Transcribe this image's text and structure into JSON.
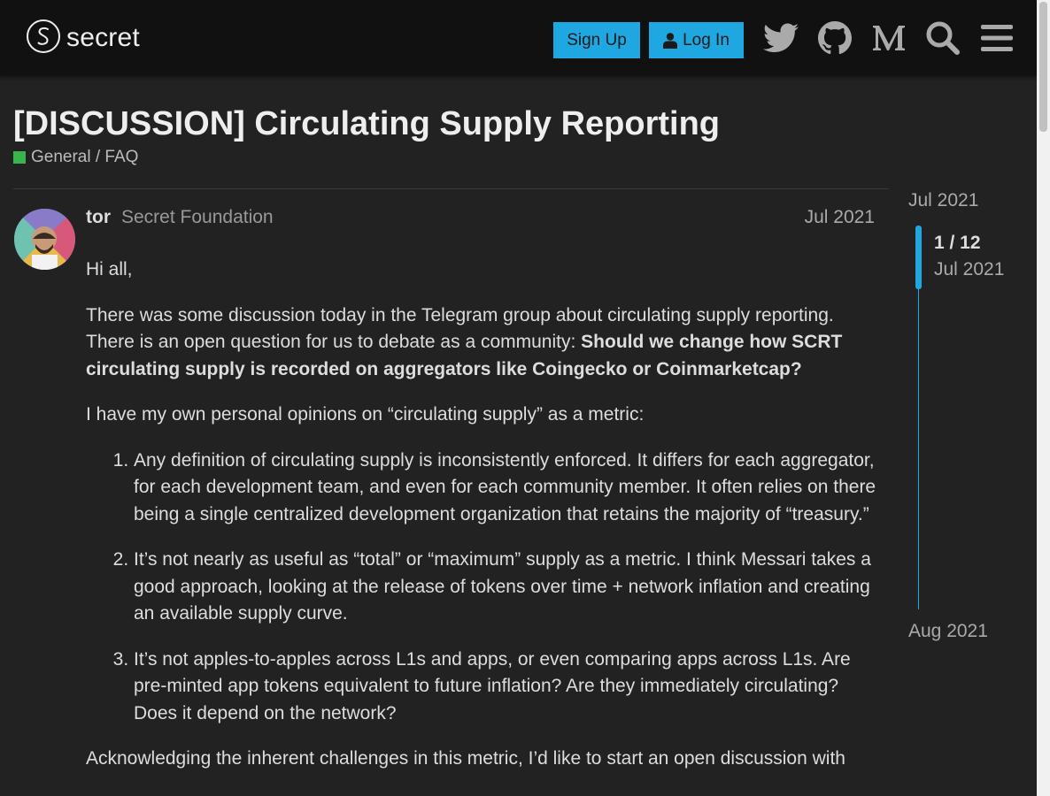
{
  "header": {
    "logo_text": "secret",
    "signup_label": "Sign Up",
    "login_label": "Log In",
    "icons": [
      "twitter-icon",
      "github-icon",
      "medium-icon",
      "search-icon",
      "hamburger-menu-icon"
    ]
  },
  "topic": {
    "title": "[DISCUSSION] Circulating Supply Reporting",
    "category": "General / FAQ",
    "category_color": "#3ab54a"
  },
  "post": {
    "username": "tor",
    "user_title": "Secret Foundation",
    "date": "Jul 2021",
    "greeting": "Hi all,",
    "para1_text": "There was some discussion today in the Telegram group about circulating supply reporting. There is an open question for us to debate as a community: ",
    "para1_bold": "Should we change how SCRT circulating supply is recorded on aggregators like Coingecko or Coinmarketcap?",
    "para2": "I have my own personal opinions on “circulating supply” as a metric:",
    "list": [
      "Any definition of circulating supply is inconsistently enforced. It differs for each aggregator, for each development team, and even for each community member. It often relies on there being a single centralized development organization that retains the majority of “treasury.”",
      "It’s not nearly as useful as “total” or “maximum” supply as a metric. I think Messari takes a good approach, looking at the release of tokens over time + network inflation and creating an available supply curve.",
      "It’s not apples-to-apples across L1s and apps, or even comparing apps across L1s. Are pre-minted app tokens equivalent to future inflation? Are they immediately circulating? Does it depend on the network?"
    ],
    "para3": "Acknowledging the inherent challenges in this metric, I’d like to start an open discussion with"
  },
  "timeline": {
    "start_date": "Jul 2021",
    "counter": "1 / 12",
    "handle_date": "Jul 2021",
    "end_date": "Aug 2021",
    "accent_color": "#1ea7e1"
  }
}
